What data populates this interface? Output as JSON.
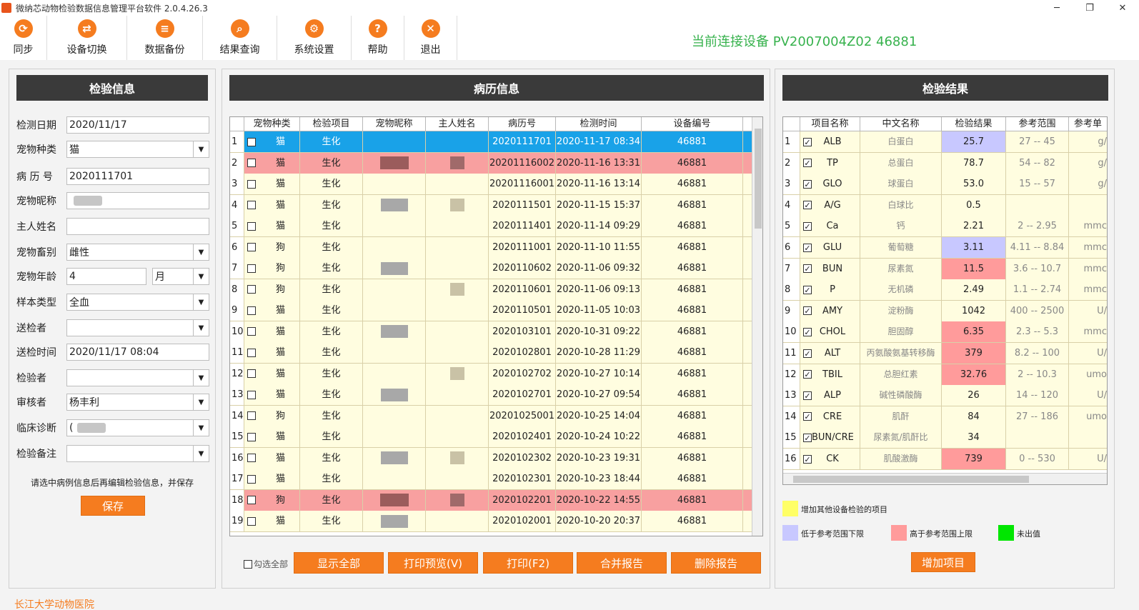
{
  "window": {
    "title": "微纳芯动物检验数据信息管理平台软件 2.0.4.26.3",
    "controls": [
      "─",
      "❐",
      "✕"
    ]
  },
  "toolbar": [
    {
      "id": "sync",
      "label": "同步",
      "icon": "sync-icon",
      "glyph": "⟳"
    },
    {
      "id": "switch",
      "label": "设备切换",
      "icon": "switch-icon",
      "glyph": "⇄"
    },
    {
      "id": "backup",
      "label": "数据备份",
      "icon": "database-icon",
      "glyph": "≡"
    },
    {
      "id": "query",
      "label": "结果查询",
      "icon": "search-icon",
      "glyph": "⌕"
    },
    {
      "id": "settings",
      "label": "系统设置",
      "icon": "gear-icon",
      "glyph": "⚙"
    },
    {
      "id": "help",
      "label": "帮助",
      "icon": "help-icon",
      "glyph": "?"
    },
    {
      "id": "exit",
      "label": "退出",
      "icon": "close-icon",
      "glyph": "✕"
    }
  ],
  "device_status": "当前连接设备  PV2007004Z02 46881",
  "left_panel": {
    "title": "检验信息",
    "fields": [
      {
        "label": "检测日期",
        "value": "2020/11/17",
        "combo": false
      },
      {
        "label": "宠物种类",
        "value": "猫",
        "combo": true
      },
      {
        "label": "病 历 号",
        "value": "2020111701",
        "combo": false
      },
      {
        "label": "宠物昵称",
        "value": "",
        "combo": false,
        "redacted": true
      },
      {
        "label": "主人姓名",
        "value": "",
        "combo": false
      },
      {
        "label": "宠物畜别",
        "value": "雌性",
        "combo": true
      },
      {
        "label": "宠物年龄",
        "value": "4",
        "unit": "月",
        "combo": false
      },
      {
        "label": "样本类型",
        "value": "全血",
        "combo": true
      },
      {
        "label": "送检者",
        "value": "",
        "combo": true
      },
      {
        "label": "送检时间",
        "value": "2020/11/17 08:04",
        "combo": false
      },
      {
        "label": "检验者",
        "value": "",
        "combo": true
      },
      {
        "label": "审核者",
        "value": "杨丰利",
        "combo": true
      },
      {
        "label": "临床诊断",
        "value": "(",
        "combo": true,
        "redacted": true
      },
      {
        "label": "检验备注",
        "value": "",
        "combo": true
      }
    ],
    "hint": "请选中病例信息后再编辑检验信息，并保存",
    "save_label": "保存"
  },
  "middle_panel": {
    "title": "病历信息",
    "columns": [
      "",
      "宠物种类",
      "检验项目",
      "宠物昵称",
      "主人姓名",
      "病历号",
      "检测时间",
      "设备编号"
    ],
    "rows": [
      {
        "idx": "1",
        "species": "猫",
        "item": "生化",
        "record": "2020111701",
        "time": "2020-11-17 08:34",
        "device": "46881",
        "state": "selected"
      },
      {
        "idx": "2",
        "species": "猫",
        "item": "生化",
        "record": "20201116002",
        "time": "2020-11-16 13:31",
        "device": "46881",
        "state": "red"
      },
      {
        "idx": "3",
        "species": "猫",
        "item": "生化",
        "record": "20201116001",
        "time": "2020-11-16 13:14",
        "device": "46881",
        "state": "normal"
      },
      {
        "idx": "4",
        "species": "猫",
        "item": "生化",
        "record": "2020111501",
        "time": "2020-11-15 15:37",
        "device": "46881",
        "state": "normal"
      },
      {
        "idx": "5",
        "species": "猫",
        "item": "生化",
        "record": "2020111401",
        "time": "2020-11-14 09:29",
        "device": "46881",
        "state": "normal"
      },
      {
        "idx": "6",
        "species": "狗",
        "item": "生化",
        "record": "2020111001",
        "time": "2020-11-10 11:55",
        "device": "46881",
        "state": "normal"
      },
      {
        "idx": "7",
        "species": "狗",
        "item": "生化",
        "record": "2020110602",
        "time": "2020-11-06 09:32",
        "device": "46881",
        "state": "normal"
      },
      {
        "idx": "8",
        "species": "狗",
        "item": "生化",
        "record": "2020110601",
        "time": "2020-11-06 09:13",
        "device": "46881",
        "state": "normal"
      },
      {
        "idx": "9",
        "species": "猫",
        "item": "生化",
        "record": "2020110501",
        "time": "2020-11-05 10:03",
        "device": "46881",
        "state": "normal"
      },
      {
        "idx": "10",
        "species": "猫",
        "item": "生化",
        "record": "2020103101",
        "time": "2020-10-31 09:22",
        "device": "46881",
        "state": "normal"
      },
      {
        "idx": "11",
        "species": "猫",
        "item": "生化",
        "record": "2020102801",
        "time": "2020-10-28 11:29",
        "device": "46881",
        "state": "normal"
      },
      {
        "idx": "12",
        "species": "猫",
        "item": "生化",
        "record": "2020102702",
        "time": "2020-10-27 10:14",
        "device": "46881",
        "state": "normal"
      },
      {
        "idx": "13",
        "species": "猫",
        "item": "生化",
        "record": "2020102701",
        "time": "2020-10-27 09:54",
        "device": "46881",
        "state": "normal"
      },
      {
        "idx": "14",
        "species": "狗",
        "item": "生化",
        "record": "20201025001",
        "time": "2020-10-25 14:04",
        "device": "46881",
        "state": "normal"
      },
      {
        "idx": "15",
        "species": "猫",
        "item": "生化",
        "record": "2020102401",
        "time": "2020-10-24 10:22",
        "device": "46881",
        "state": "normal"
      },
      {
        "idx": "16",
        "species": "猫",
        "item": "生化",
        "record": "2020102302",
        "time": "2020-10-23 19:31",
        "device": "46881",
        "state": "normal"
      },
      {
        "idx": "17",
        "species": "猫",
        "item": "生化",
        "record": "2020102301",
        "time": "2020-10-23 18:44",
        "device": "46881",
        "state": "normal"
      },
      {
        "idx": "18",
        "species": "狗",
        "item": "生化",
        "record": "2020102201",
        "time": "2020-10-22 14:55",
        "device": "46881",
        "state": "red"
      },
      {
        "idx": "19",
        "species": "猫",
        "item": "生化",
        "record": "2020102001",
        "time": "2020-10-20 20:37",
        "device": "46881",
        "state": "normal"
      }
    ],
    "select_all_label": "勾选全部",
    "buttons": [
      "显示全部",
      "打印预览(V)",
      "打印(F2)",
      "合并报告",
      "删除报告"
    ]
  },
  "right_panel": {
    "title": "检验结果",
    "columns": [
      "",
      "项目名称",
      "中文名称",
      "检验结果",
      "参考范围",
      "参考单"
    ],
    "rows": [
      {
        "idx": "1",
        "code": "ALB",
        "name": "白蛋白",
        "result": "25.7",
        "range": "27 -- 45",
        "unit": "g/",
        "flag": "low"
      },
      {
        "idx": "2",
        "code": "TP",
        "name": "总蛋白",
        "result": "78.7",
        "range": "54 -- 82",
        "unit": "g/",
        "flag": "normal"
      },
      {
        "idx": "3",
        "code": "GLO",
        "name": "球蛋白",
        "result": "53.0",
        "range": "15 -- 57",
        "unit": "g/",
        "flag": "normal"
      },
      {
        "idx": "4",
        "code": "A/G",
        "name": "白球比",
        "result": "0.5",
        "range": "",
        "unit": "",
        "flag": "normal"
      },
      {
        "idx": "5",
        "code": "Ca",
        "name": "钙",
        "result": "2.21",
        "range": "2 -- 2.95",
        "unit": "mmc",
        "flag": "normal"
      },
      {
        "idx": "6",
        "code": "GLU",
        "name": "葡萄糖",
        "result": "3.11",
        "range": "4.11 -- 8.84",
        "unit": "mmc",
        "flag": "low"
      },
      {
        "idx": "7",
        "code": "BUN",
        "name": "尿素氮",
        "result": "11.5",
        "range": "3.6 -- 10.7",
        "unit": "mmc",
        "flag": "high"
      },
      {
        "idx": "8",
        "code": "P",
        "name": "无机磷",
        "result": "2.49",
        "range": "1.1 -- 2.74",
        "unit": "mmc",
        "flag": "normal"
      },
      {
        "idx": "9",
        "code": "AMY",
        "name": "淀粉酶",
        "result": "1042",
        "range": "400 -- 2500",
        "unit": "U/",
        "flag": "normal"
      },
      {
        "idx": "10",
        "code": "CHOL",
        "name": "胆固醇",
        "result": "6.35",
        "range": "2.3 -- 5.3",
        "unit": "mmc",
        "flag": "high"
      },
      {
        "idx": "11",
        "code": "ALT",
        "name": "丙氨酸氨基转移酶",
        "result": "379",
        "range": "8.2 -- 100",
        "unit": "U/",
        "flag": "high"
      },
      {
        "idx": "12",
        "code": "TBIL",
        "name": "总胆红素",
        "result": "32.76",
        "range": "2 -- 10.3",
        "unit": "umo",
        "flag": "high"
      },
      {
        "idx": "13",
        "code": "ALP",
        "name": "碱性磷酸酶",
        "result": "26",
        "range": "14 -- 120",
        "unit": "U/",
        "flag": "normal"
      },
      {
        "idx": "14",
        "code": "CRE",
        "name": "肌酐",
        "result": "84",
        "range": "27 -- 186",
        "unit": "umo",
        "flag": "normal"
      },
      {
        "idx": "15",
        "code": "BUN/CRE",
        "name": "尿素氮/肌酐比",
        "result": "34",
        "range": "",
        "unit": "",
        "flag": "normal"
      },
      {
        "idx": "16",
        "code": "CK",
        "name": "肌酸激酶",
        "result": "739",
        "range": "0 -- 530",
        "unit": "U/",
        "flag": "high"
      }
    ],
    "legend": [
      {
        "label": "增加其他设备检验的项目",
        "color": "#ffff66"
      },
      {
        "label": "低于参考范围下限",
        "color": "#c8c8ff"
      },
      {
        "label": "高于参考范围上限",
        "color": "#ff9b9b"
      },
      {
        "label": "未出值",
        "color": "#00e600"
      }
    ],
    "add_label": "增加项目"
  },
  "footer": "长江大学动物医院",
  "colors": {
    "accent": "#f57c1f",
    "selected_row": "#19a2e8",
    "alert_row": "#f8a0a0",
    "row_bg": "#fffde0",
    "header_bar": "#3a3a3a",
    "status_green": "#37b24d"
  }
}
